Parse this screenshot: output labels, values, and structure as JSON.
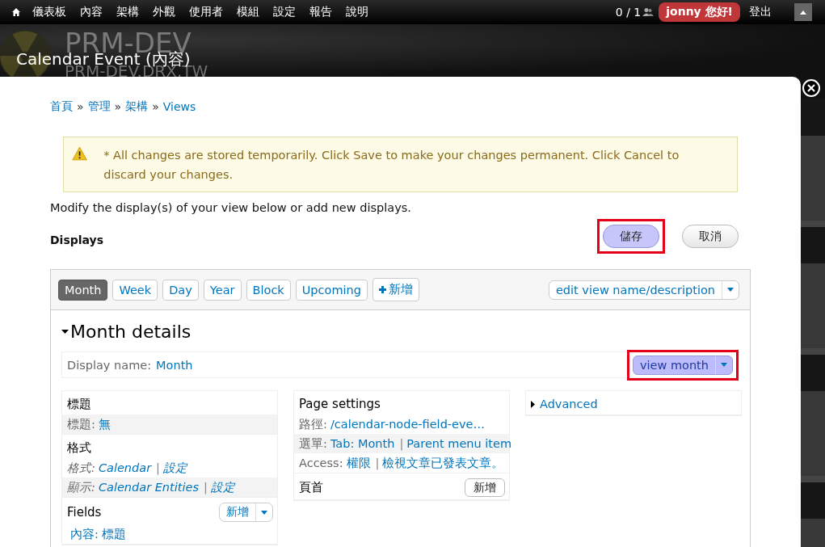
{
  "toolbar": {
    "items": [
      "儀表板",
      "內容",
      "架構",
      "外觀",
      "使用者",
      "模組",
      "設定",
      "報告",
      "說明"
    ],
    "counter": "0 / 1",
    "user": "jonny 您好!",
    "logout": "登出"
  },
  "header": {
    "site_name": "PRM-DEV",
    "slogan": "PRM-DEV.DRX.TW",
    "title": "Calendar Event (內容)"
  },
  "breadcrumb": {
    "separator": "»",
    "items": [
      "首頁",
      "管理",
      "架構",
      "Views"
    ]
  },
  "warning": "* All changes are stored temporarily. Click Save to make your changes permanent. Click Cancel to discard your changes.",
  "intro": "Modify the display(s) of your view below or add new displays.",
  "displays_label": "Displays",
  "actions": [
    {
      "label": "儲存",
      "highlighted": true
    },
    {
      "label": "取消",
      "highlighted": false
    }
  ],
  "tabs": [
    {
      "label": "Month",
      "selected": true
    },
    {
      "label": "Week",
      "selected": false
    },
    {
      "label": "Day",
      "selected": false
    },
    {
      "label": "Year",
      "selected": false
    },
    {
      "label": "Block",
      "selected": false
    },
    {
      "label": "Upcoming",
      "selected": false
    }
  ],
  "add_display": "新增",
  "edit_button": "edit view name/description",
  "details": {
    "title": "Month details",
    "display_name_label": "Display name:",
    "display_name": "Month",
    "view_button": {
      "label": "view month",
      "highlighted": true
    }
  },
  "columns": [
    [
      {
        "title": "標題",
        "rows": [
          {
            "label": "標題:",
            "links": [
              "無"
            ],
            "shaded": true,
            "italic": false
          }
        ]
      },
      {
        "title": "格式",
        "rows": [
          {
            "label": "格式:",
            "links": [
              "Calendar",
              "設定"
            ],
            "separator": "|",
            "shaded": false,
            "italic": true
          },
          {
            "label": "顯示:",
            "links": [
              "Calendar Entities",
              "設定"
            ],
            "separator": "|",
            "shaded": true,
            "italic": true
          }
        ]
      },
      {
        "title": "Fields",
        "button": {
          "label": "新增",
          "dropdown": true
        },
        "rows": [
          {
            "links": [
              "內容: 標題"
            ],
            "shaded": false,
            "italic": false
          }
        ]
      }
    ],
    [
      {
        "title": "Page settings",
        "rows": [
          {
            "label": "路徑:",
            "links": [
              "/calendar-node-field-eve…"
            ],
            "shaded": false,
            "italic": false
          },
          {
            "label": "選單:",
            "links": [
              "Tab: Month",
              "Parent menu item"
            ],
            "separator": "|",
            "shaded": true,
            "italic": false
          },
          {
            "label": "Access:",
            "links": [
              "權限",
              "檢視文章已發表文章。"
            ],
            "separator": "|",
            "shaded": false,
            "italic": false
          }
        ]
      },
      {
        "title": "頁首",
        "button": {
          "label": "新增",
          "dropdown": false
        }
      }
    ],
    [
      {
        "title": "Advanced",
        "collapsed": true
      }
    ]
  ]
}
